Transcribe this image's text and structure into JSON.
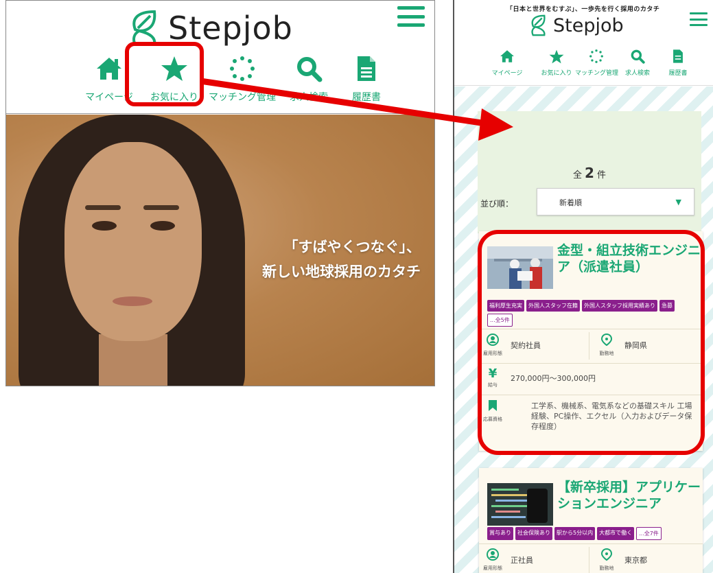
{
  "left": {
    "brand": "Stepjob",
    "nav": [
      {
        "icon": "home-icon",
        "label": "マイページ"
      },
      {
        "icon": "star-icon",
        "label": "お気に入り"
      },
      {
        "icon": "matching-icon",
        "label": "マッチング管理"
      },
      {
        "icon": "search-icon",
        "label": "求人検索"
      },
      {
        "icon": "document-icon",
        "label": "履歴書"
      }
    ],
    "hero": {
      "line1": "「すばやくつなぐ」、",
      "line2": "新しい地球採用のカタチ"
    }
  },
  "right": {
    "banner": "「日本と世界をむすぶ」、一歩先を行く採用のカタチ",
    "brand": "Stepjob",
    "nav": [
      {
        "icon": "home-icon",
        "label": "マイページ"
      },
      {
        "icon": "star-icon",
        "label": "お気に入り"
      },
      {
        "icon": "matching-icon",
        "label": "マッチング管理"
      },
      {
        "icon": "search-icon",
        "label": "求人検索"
      },
      {
        "icon": "document-icon",
        "label": "履歴書"
      }
    ],
    "count_prefix": "全",
    "count": "2",
    "count_suffix": "件",
    "sort_label": "並び順：",
    "sort_value": "新着順",
    "jobs": [
      {
        "title": "金型・組立技術エンジニア（派遣社員）",
        "tags": [
          "福利厚生充実",
          "外国人スタッフ在籍",
          "外国人スタッフ採用実績あり",
          "急募"
        ],
        "more_tag": "...全5件",
        "employment_label": "雇用形態",
        "employment": "契約社員",
        "location_label": "勤務地",
        "location": "静岡県",
        "salary_label": "給与",
        "salary": "270,000円～300,000円",
        "qualification_label": "応募資格",
        "qualification": "工学系、機械系、電気系などの基礎スキル 工場経験、PC操作、エクセル（入力およびデータ保存程度）"
      },
      {
        "title": "【新卒採用】アプリケーションエンジニア",
        "tags": [
          "賞与あり",
          "社会保険あり",
          "駅から5分以内",
          "大都市で働く"
        ],
        "more_tag": "...全7件",
        "employment_label": "雇用形態",
        "employment": "正社員",
        "location_label": "勤務地",
        "location": "東京都"
      }
    ]
  },
  "colors": {
    "accent": "#1aa774",
    "highlight": "#e60000",
    "tag": "#8a1f8c"
  }
}
